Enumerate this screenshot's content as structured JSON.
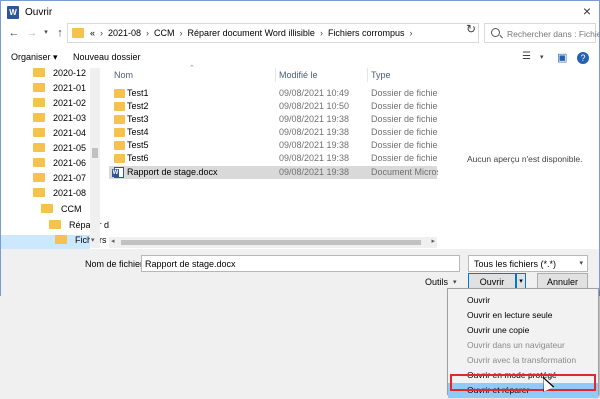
{
  "window": {
    "title": "Ouvrir",
    "app_icon": "W"
  },
  "address": {
    "crumbs": [
      "«",
      "2021-08",
      "CCM",
      "Réparer document Word illisible",
      "Fichiers corrompus"
    ],
    "separator": "›",
    "search_placeholder": "Rechercher dans : Fichiers co..."
  },
  "toolbar": {
    "organize": "Organiser ▾",
    "new_folder": "Nouveau dossier"
  },
  "nav": {
    "items": [
      {
        "label": "2020-12"
      },
      {
        "label": "2021-01"
      },
      {
        "label": "2021-02"
      },
      {
        "label": "2021-03"
      },
      {
        "label": "2021-04"
      },
      {
        "label": "2021-05"
      },
      {
        "label": "2021-06"
      },
      {
        "label": "2021-07"
      },
      {
        "label": "2021-08"
      },
      {
        "label": "CCM"
      },
      {
        "label": "Réparer d"
      },
      {
        "label": "Fichiers"
      }
    ]
  },
  "files": {
    "columns": {
      "name": "Nom",
      "date": "Modifié le",
      "type": "Type"
    },
    "rows": [
      {
        "name": "Test1",
        "date": "09/08/2021 10:49",
        "type": "Dossier de fichiers",
        "icon": "folder-icon"
      },
      {
        "name": "Test2",
        "date": "09/08/2021 10:50",
        "type": "Dossier de fichiers",
        "icon": "folder-icon"
      },
      {
        "name": "Test3",
        "date": "09/08/2021 19:38",
        "type": "Dossier de fichiers",
        "icon": "folder-icon"
      },
      {
        "name": "Test4",
        "date": "09/08/2021 19:38",
        "type": "Dossier de fichiers",
        "icon": "folder-icon"
      },
      {
        "name": "Test5",
        "date": "09/08/2021 19:38",
        "type": "Dossier de fichiers",
        "icon": "folder-icon"
      },
      {
        "name": "Test6",
        "date": "09/08/2021 19:38",
        "type": "Dossier de fichiers",
        "icon": "folder-icon"
      },
      {
        "name": "Rapport de stage.docx",
        "date": "09/08/2021 19:38",
        "type": "Document Micros...",
        "icon": "word-doc-icon"
      }
    ]
  },
  "preview": {
    "text": "Aucun aperçu n'est disponible."
  },
  "bottom": {
    "filename_label": "Nom de fichier :",
    "filename_value": "Rapport de stage.docx",
    "filetype": "Tous les fichiers (*.*)",
    "tools": "Outils",
    "open": "Ouvrir",
    "cancel": "Annuler"
  },
  "menu": {
    "items": [
      {
        "label": "Ouvrir",
        "enabled": true
      },
      {
        "label": "Ouvrir en lecture seule",
        "enabled": true
      },
      {
        "label": "Ouvrir une copie",
        "enabled": true
      },
      {
        "label": "Ouvrir dans un navigateur",
        "enabled": false
      },
      {
        "label": "Ouvrir avec la transformation",
        "enabled": false
      },
      {
        "label": "Ouvrir en mode protégé",
        "enabled": true
      },
      {
        "label": "Ouvrir et réparer",
        "enabled": true,
        "highlighted": true
      }
    ]
  },
  "colors": {
    "folder": "#f4c24d",
    "word": "#2b579a",
    "selection": "#cce8ff",
    "menu_highlight": "#91c9f7",
    "annotation_red": "#e0282e"
  }
}
